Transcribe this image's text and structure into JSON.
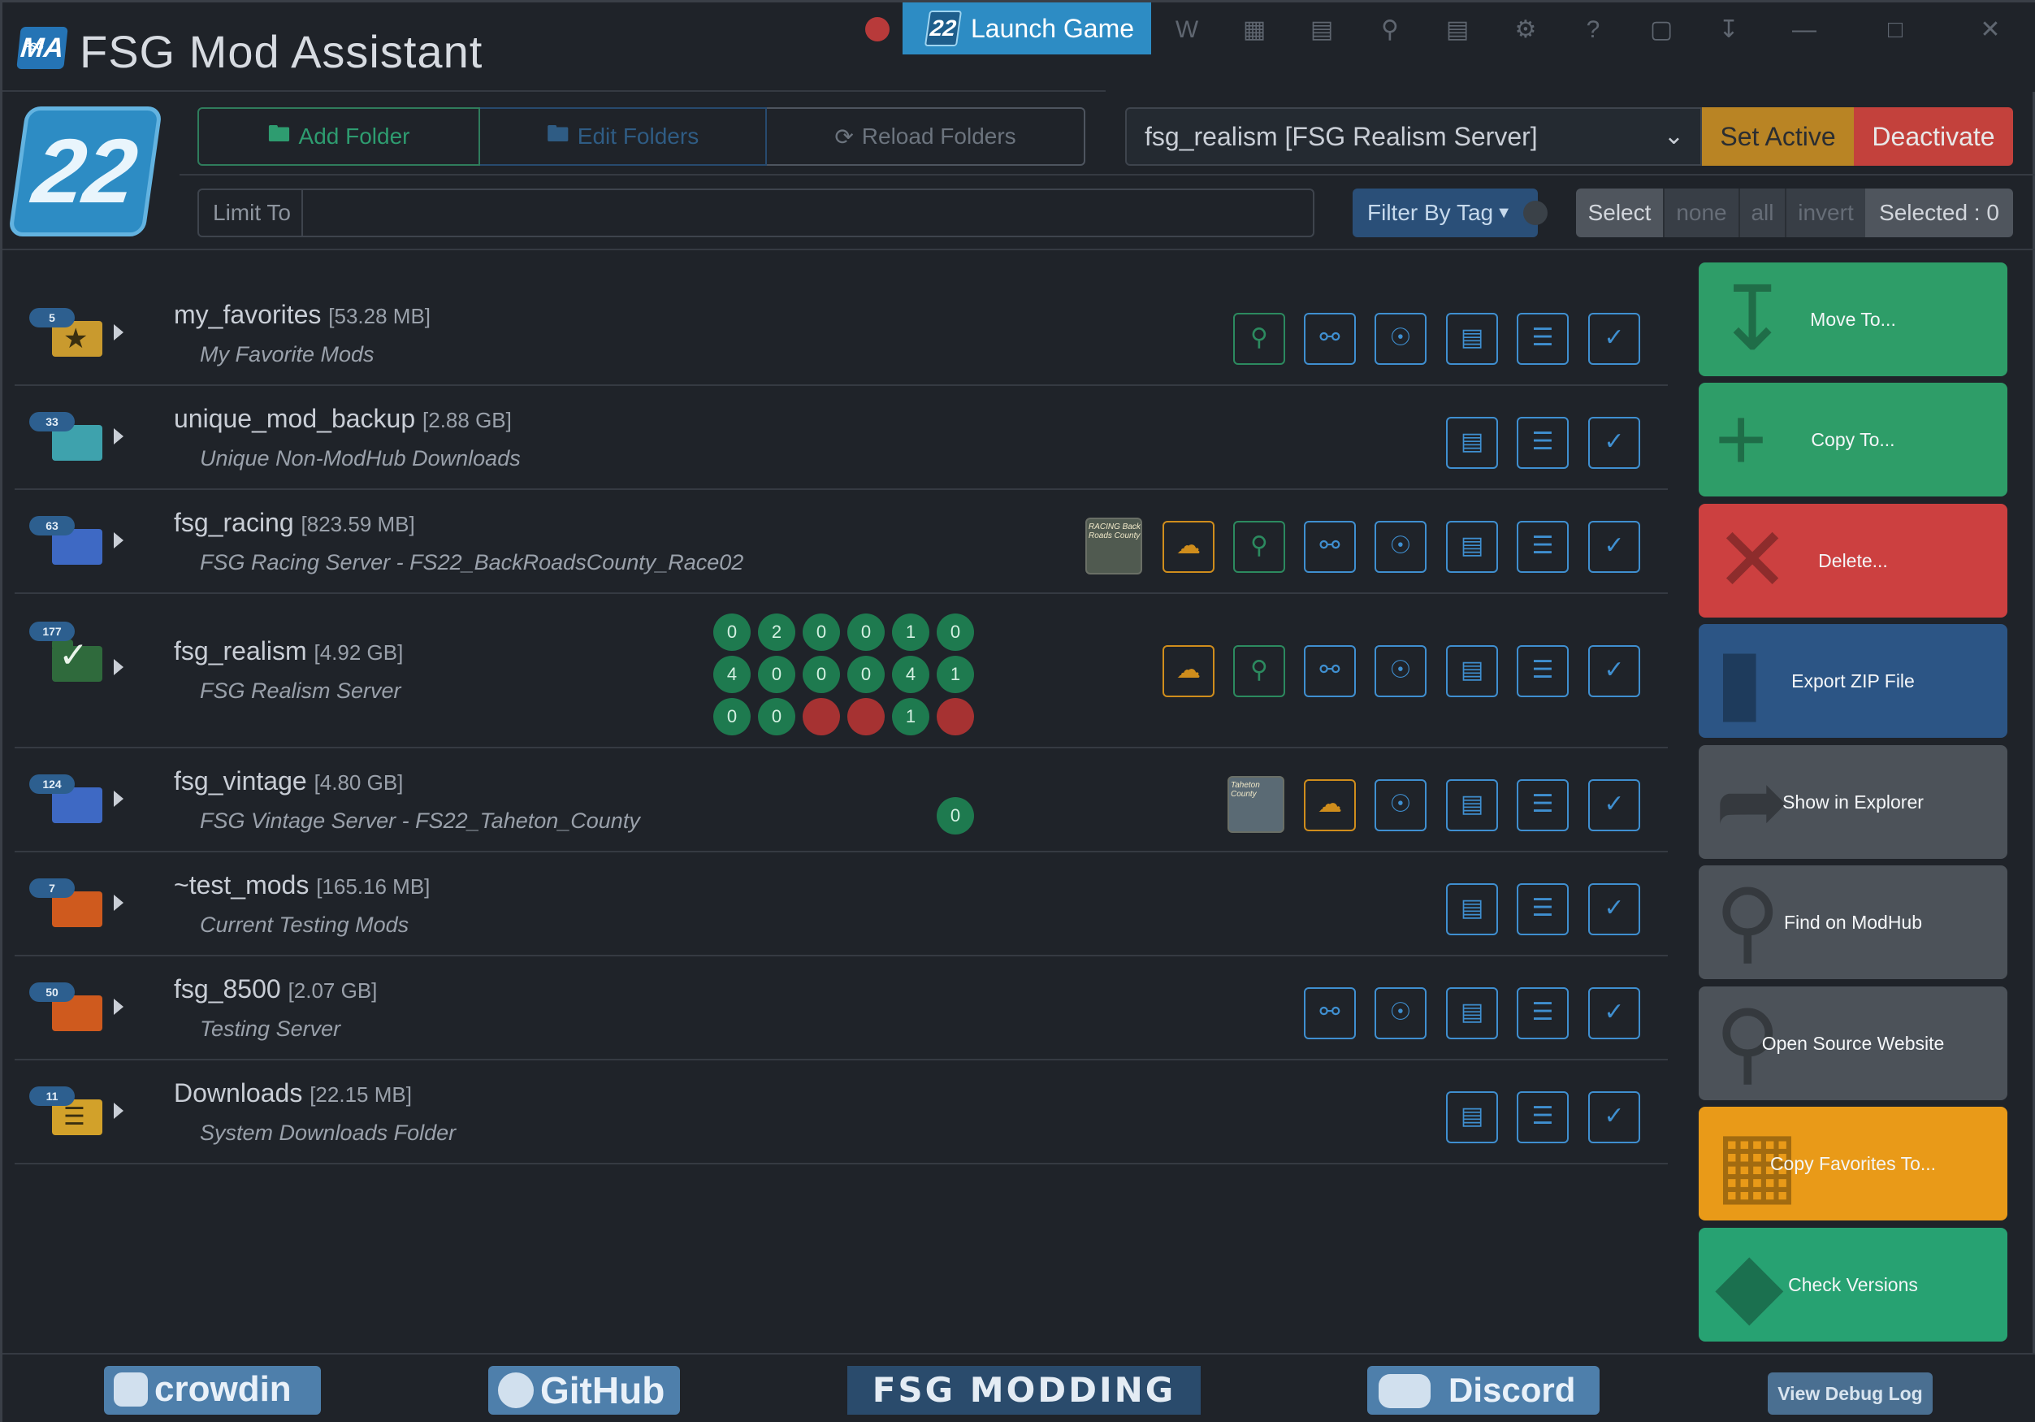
{
  "app": {
    "title": "FSG Mod Assistant",
    "logo_text": "MA",
    "logo_small": "FSG",
    "game_badge": "22"
  },
  "titlebar": {
    "launch_label": "Launch Game",
    "icons": [
      "wiki-icon",
      "calendar-icon",
      "printer-icon",
      "search-icon",
      "notes-icon",
      "gear-icon",
      "help-icon",
      "window-icon",
      "download-icon",
      "minimize-icon",
      "maximize-icon",
      "close-icon"
    ]
  },
  "toolbar": {
    "add_folder": "Add Folder",
    "edit_folders": "Edit Folders",
    "reload_folders": "Reload Folders",
    "collection_value": "fsg_realism [FSG Realism Server]",
    "set_active": "Set Active",
    "deactivate": "Deactivate",
    "limit_label": "Limit To",
    "limit_value": "",
    "filter_by_tag": "Filter By Tag",
    "select": "Select",
    "none": "none",
    "all": "all",
    "invert": "invert",
    "selected_count": "Selected : 0"
  },
  "folders": [
    {
      "count": "5",
      "name": "my_favorites",
      "size": "[53.28 MB]",
      "desc": "My Favorite Mods"
    },
    {
      "count": "33",
      "name": "unique_mod_backup",
      "size": "[2.88 GB]",
      "desc": "Unique Non-ModHub Downloads"
    },
    {
      "count": "63",
      "name": "fsg_racing",
      "size": "[823.59 MB]",
      "desc": "FSG Racing Server - FS22_BackRoadsCounty_Race02",
      "thumb_text": "RACING Back Roads County"
    },
    {
      "count": "177",
      "name": "fsg_realism",
      "size": "[4.92 GB]",
      "desc": "FSG Realism Server"
    },
    {
      "count": "124",
      "name": "fsg_vintage",
      "size": "[4.80 GB]",
      "desc": "FSG Vintage Server - FS22_Taheton_County",
      "thumb_text": "Taheton County",
      "issue_count": "0"
    },
    {
      "count": "7",
      "name": "~test_mods",
      "size": "[165.16 MB]",
      "desc": "Current Testing Mods"
    },
    {
      "count": "50",
      "name": "fsg_8500",
      "size": "[2.07 GB]",
      "desc": "Testing Server"
    },
    {
      "count": "11",
      "name": "Downloads",
      "size": "[22.15 MB]",
      "desc": "System Downloads Folder"
    }
  ],
  "realism_stats": [
    [
      "0",
      "2",
      "0",
      "0",
      "1",
      "0"
    ],
    [
      "4",
      "0",
      "0",
      "0",
      "4",
      "1"
    ],
    [
      "0",
      "0",
      "",
      "",
      "1",
      ""
    ]
  ],
  "sidebar": {
    "move_to": "Move To...",
    "copy_to": "Copy To...",
    "delete": "Delete...",
    "export_zip": "Export ZIP File",
    "show_in_explorer": "Show in Explorer",
    "find_on_modhub": "Find on ModHub",
    "open_source": "Open Source Website",
    "copy_favorites": "Copy Favorites To...",
    "check_versions": "Check Versions"
  },
  "footer": {
    "crowdin": "crowdin",
    "github": "GitHub",
    "fsg_modding": "FSG MODDING",
    "discord": "Discord",
    "debug_log": "View Debug Log"
  },
  "colors": {
    "accent": "#2d8cc4",
    "green": "#2e9d68",
    "red": "#cc4040",
    "orange": "#e99a18",
    "blue": "#2c5585",
    "background": "#1f2329"
  }
}
